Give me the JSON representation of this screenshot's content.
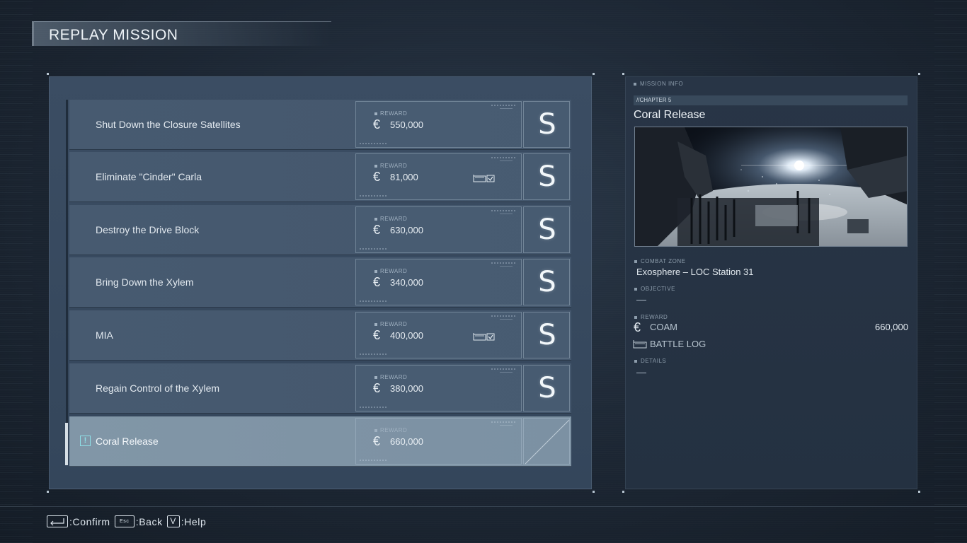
{
  "header": {
    "title": "REPLAY MISSION"
  },
  "missions": [
    {
      "name": "Shut Down the Closure Satellites",
      "reward_label": "REWARD",
      "reward": "550,000",
      "rank": "S",
      "has_log": false
    },
    {
      "name": "Eliminate \"Cinder\" Carla",
      "reward_label": "REWARD",
      "reward": "81,000",
      "rank": "S",
      "has_log": true
    },
    {
      "name": "Destroy the Drive Block",
      "reward_label": "REWARD",
      "reward": "630,000",
      "rank": "S",
      "has_log": false
    },
    {
      "name": "Bring Down the Xylem",
      "reward_label": "REWARD",
      "reward": "340,000",
      "rank": "S",
      "has_log": false
    },
    {
      "name": "MIA",
      "reward_label": "REWARD",
      "reward": "400,000",
      "rank": "S",
      "has_log": true
    },
    {
      "name": "Regain Control of the Xylem",
      "reward_label": "REWARD",
      "reward": "380,000",
      "rank": "S",
      "has_log": false
    },
    {
      "name": "Coral Release",
      "reward_label": "REWARD",
      "reward": "660,000",
      "rank": "",
      "has_log": false,
      "selected": true,
      "alert_icon": "!"
    }
  ],
  "info": {
    "section_label": "MISSION INFO",
    "chapter": "//CHAPTER 5",
    "title": "Coral Release",
    "combat_zone_label": "COMBAT ZONE",
    "combat_zone": "Exosphere – LOC Station 31",
    "objective_label": "OBJECTIVE",
    "reward_label": "REWARD",
    "currency": "COAM",
    "reward_value": "660,000",
    "battle_log": "BATTLE LOG",
    "details_label": "DETAILS"
  },
  "footer": {
    "confirm": ":Confirm",
    "esc_key": "Esc",
    "back": ":Back",
    "v_key": "V",
    "help": ":Help"
  },
  "colors": {
    "accent_cyan": "#8ee0e8",
    "panel": "#3b4d63",
    "selected_row": "#8196a7"
  },
  "icons": {
    "currency": "euro-sign-icon",
    "log": "battle-log-icon",
    "enter": "enter-key-icon"
  }
}
